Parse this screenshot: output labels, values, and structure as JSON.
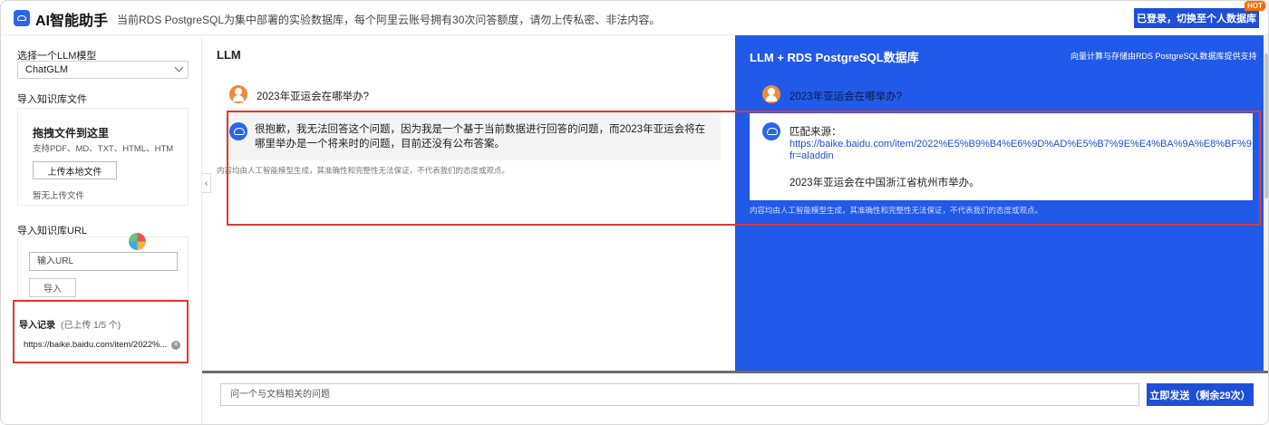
{
  "header": {
    "title": "AI智能助手",
    "notice": "当前RDS PostgreSQL为集中部署的实验数据库，每个阿里云账号拥有30次问答额度，请勿上传私密、非法内容。",
    "login_button": "已登录，切换至个人数据库",
    "hot_badge": "HOT"
  },
  "sidebar": {
    "model_label": "选择一个LLM模型",
    "model_selected": "ChatGLM",
    "file_import_label": "导入知识库文件",
    "drop_title": "拖拽文件到这里",
    "supported_formats": "支持PDF、MD、TXT、HTML、HTM",
    "upload_button": "上传本地文件",
    "no_upload": "暂无上传文件",
    "url_import_label": "导入知识库URL",
    "url_placeholder": "输入URL",
    "url_import_button": "导入",
    "record_label": "导入记录",
    "record_count": "(已上传 1/5 个)",
    "record_item": "https://baike.baidu.com/item/2022%..."
  },
  "llm_panel": {
    "title": "LLM",
    "question": "2023年亚运会在哪举办?",
    "answer": "很抱歉，我无法回答这个问题，因为我是一个基于当前数据进行回答的问题，而2023年亚运会将在哪里举办是一个将来时的问题，目前还没有公布答案。",
    "disclaimer": "内容均由人工智能模型生成，其准确性和完整性无法保证，不代表我们的态度或观点。"
  },
  "rds_panel": {
    "title": "LLM + RDS PostgreSQL数据库",
    "description": "向量计算与存储由RDS PostgreSQL数据库提供支持",
    "question": "2023年亚运会在哪举办?",
    "match_label": "匹配来源：",
    "match_url_line1": "https://baike.baidu.com/item/2022%E5%B9%B4%E6%9D%AD%E5%B7%9E%E4%BA%9A%E8%BF%90%E4%BC",
    "match_url_line2": "fr=aladdin",
    "answer": "2023年亚运会在中国浙江省杭州市举办。",
    "disclaimer": "内容均由人工智能模型生成，其准确性和完整性无法保证，不代表我们的态度或观点。"
  },
  "chat": {
    "input_placeholder": "问一个与文档相关的问题",
    "send_button": "立即发送（剩余29次）"
  },
  "colors": {
    "brand_blue": "#1e4fd8",
    "rds_panel_bg": "#2159e8",
    "highlight_red": "#e03a2e"
  }
}
